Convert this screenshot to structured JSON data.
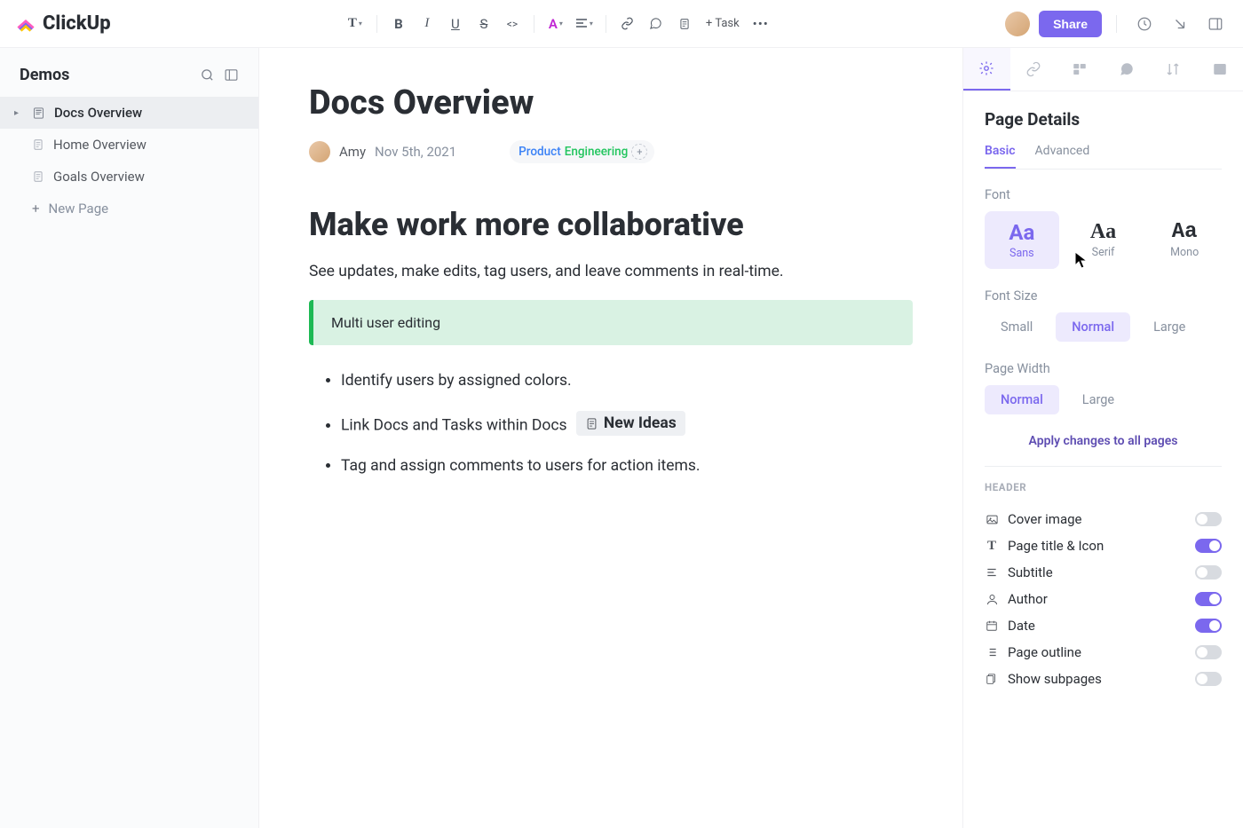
{
  "app": {
    "name": "ClickUp"
  },
  "toolbar": {
    "task": "Task",
    "share": "Share"
  },
  "sidebar": {
    "title": "Demos",
    "items": [
      {
        "label": "Docs Overview",
        "active": true
      },
      {
        "label": "Home Overview",
        "active": false
      },
      {
        "label": "Goals Overview",
        "active": false
      }
    ],
    "new_page": "New Page"
  },
  "doc": {
    "title": "Docs Overview",
    "author": "Amy",
    "date": "Nov 5th, 2021",
    "tags": {
      "product": "Product",
      "engineering": "Engineering"
    },
    "heading": "Make work more collaborative",
    "subhead": "See updates, make edits, tag users, and leave comments in real-time.",
    "callout": "Multi user editing",
    "bullets": {
      "b1": "Identify users by assigned colors.",
      "b2": "Link Docs and Tasks within Docs",
      "b2_doc": "New Ideas",
      "b3": "Tag and assign comments to users for action items."
    }
  },
  "panel": {
    "title": "Page Details",
    "tabs": {
      "basic": "Basic",
      "advanced": "Advanced"
    },
    "font": {
      "label": "Font",
      "sans": "Sans",
      "serif": "Serif",
      "mono": "Mono",
      "aa": "Aa"
    },
    "font_size": {
      "label": "Font Size",
      "small": "Small",
      "normal": "Normal",
      "large": "Large"
    },
    "page_width": {
      "label": "Page Width",
      "normal": "Normal",
      "large": "Large"
    },
    "apply": "Apply changes to all pages",
    "header_section": "HEADER",
    "toggles": {
      "cover": "Cover image",
      "title_icon": "Page title & Icon",
      "subtitle": "Subtitle",
      "author": "Author",
      "date": "Date",
      "outline": "Page outline",
      "subpages": "Show subpages"
    },
    "toggle_state": {
      "cover": false,
      "title_icon": true,
      "subtitle": false,
      "author": true,
      "date": true,
      "outline": false,
      "subpages": false
    }
  }
}
